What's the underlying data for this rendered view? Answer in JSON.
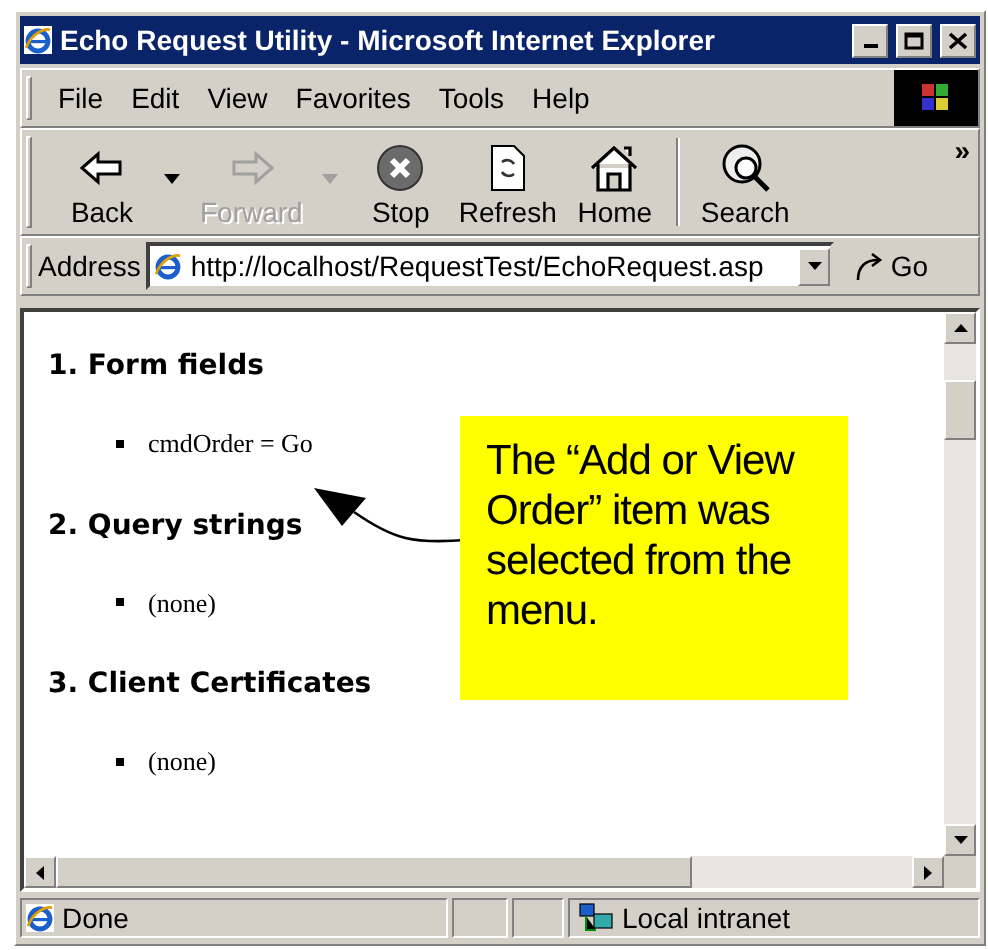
{
  "window": {
    "title": "Echo Request Utility - Microsoft Internet Explorer"
  },
  "menu": [
    "File",
    "Edit",
    "View",
    "Favorites",
    "Tools",
    "Help"
  ],
  "toolbar": [
    {
      "kind": "back",
      "label": "Back",
      "disabled": false,
      "dropdown": true
    },
    {
      "kind": "forward",
      "label": "Forward",
      "disabled": true,
      "dropdown": true
    },
    {
      "kind": "stop",
      "label": "Stop",
      "disabled": false,
      "dropdown": false
    },
    {
      "kind": "refresh",
      "label": "Refresh",
      "disabled": false,
      "dropdown": false
    },
    {
      "kind": "home",
      "label": "Home",
      "disabled": false,
      "dropdown": false
    },
    {
      "kind": "search",
      "label": "Search",
      "disabled": false,
      "dropdown": false
    }
  ],
  "toolbar_more": "»",
  "address": {
    "label": "Address",
    "value": "http://localhost/RequestTest/EchoRequest.asp",
    "go": "Go"
  },
  "sections": [
    {
      "heading": "1. Form fields",
      "items": [
        "cmdOrder = Go"
      ]
    },
    {
      "heading": "2. Query strings",
      "items": [
        "(none)"
      ]
    },
    {
      "heading": "3. Client Certificates",
      "items": [
        "(none)"
      ]
    }
  ],
  "callout": "The “Add or View Order” item was selected from the menu.",
  "status_bar": {
    "text": "Done",
    "zone": "Local intranet"
  }
}
